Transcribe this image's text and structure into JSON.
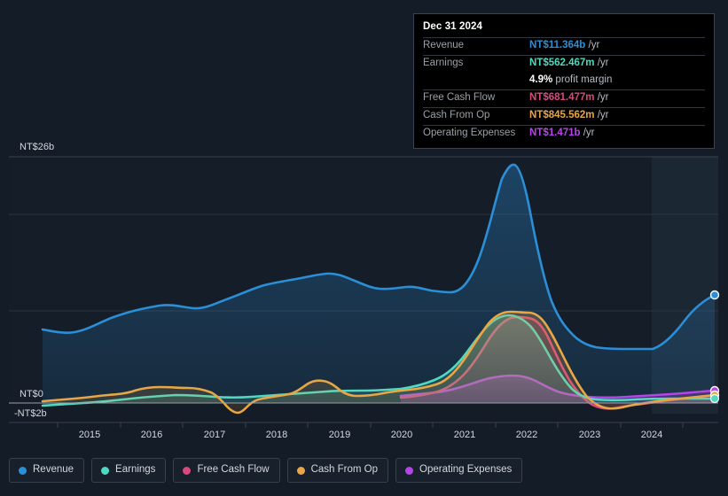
{
  "colors": {
    "background": "#141c27",
    "plot_background": "#151d28",
    "revenue": "#2b8fd8",
    "earnings": "#4fd9c0",
    "free_cash_flow": "#d64a7e",
    "cash_from_op": "#e8a646",
    "operating_expenses": "#b545e8",
    "gridline": "#3a414c",
    "zero_line": "#9aa0a8",
    "tooltip_background": "#000000",
    "tooltip_border": "#3c4350"
  },
  "tooltip": {
    "date": "Dec 31 2024",
    "rows": [
      {
        "label": "Revenue",
        "value": "NT$11.364b",
        "unit": "/yr",
        "color": "#2b8fd8"
      },
      {
        "label": "Earnings",
        "value": "NT$562.467m",
        "unit": "/yr",
        "color": "#4fd9c0"
      },
      {
        "label": "",
        "value": "4.9%",
        "unit": "profit margin",
        "color": "#ffffff"
      },
      {
        "label": "Free Cash Flow",
        "value": "NT$681.477m",
        "unit": "/yr",
        "color": "#d64a7e"
      },
      {
        "label": "Cash From Op",
        "value": "NT$845.562m",
        "unit": "/yr",
        "color": "#e8a646"
      },
      {
        "label": "Operating Expenses",
        "value": "NT$1.471b",
        "unit": "/yr",
        "color": "#b545e8"
      }
    ]
  },
  "legend": {
    "items": [
      {
        "label": "Revenue",
        "color": "#2b8fd8"
      },
      {
        "label": "Earnings",
        "color": "#4fd9c0"
      },
      {
        "label": "Free Cash Flow",
        "color": "#d64a7e"
      },
      {
        "label": "Cash From Op",
        "color": "#e8a646"
      },
      {
        "label": "Operating Expenses",
        "color": "#b545e8"
      }
    ]
  },
  "axis": {
    "y_top_label": "NT$26b",
    "y_zero_label": "NT$0",
    "y_bottom_label": "-NT$2b",
    "x_labels": [
      "2015",
      "2016",
      "2017",
      "2018",
      "2019",
      "2020",
      "2021",
      "2022",
      "2023",
      "2024"
    ]
  },
  "chart_data": {
    "type": "area",
    "title": "",
    "xlabel": "",
    "ylabel": "",
    "ylim": [
      -2,
      26
    ],
    "currency": "NT$",
    "units": "billions",
    "grid": true,
    "legend_position": "bottom",
    "x": [
      2014.5,
      2015.0,
      2015.5,
      2016.0,
      2016.5,
      2017.0,
      2017.5,
      2018.0,
      2018.5,
      2019.0,
      2019.5,
      2020.0,
      2020.5,
      2021.0,
      2021.5,
      2021.8,
      2022.0,
      2022.5,
      2023.0,
      2023.5,
      2024.0,
      2024.5,
      2025.0
    ],
    "x_tick_labels": [
      "2015",
      "2016",
      "2017",
      "2018",
      "2019",
      "2020",
      "2021",
      "2022",
      "2023",
      "2024"
    ],
    "series": [
      {
        "name": "Revenue",
        "color": "#2b8fd8",
        "values": [
          7.6,
          7.3,
          7.8,
          8.6,
          8.5,
          9.3,
          9.8,
          9.6,
          10.3,
          10.4,
          10.0,
          10.2,
          10.7,
          11.0,
          19.5,
          25.6,
          23.5,
          14.0,
          9.3,
          9.1,
          9.0,
          10.2,
          11.364
        ],
        "latest_value": "NT$11.364b"
      },
      {
        "name": "Earnings",
        "color": "#4fd9c0",
        "values": [
          -0.35,
          -0.3,
          -0.15,
          0.05,
          0.1,
          0.1,
          0.05,
          0.1,
          0.15,
          0.2,
          0.25,
          0.35,
          0.6,
          1.4,
          3.9,
          5.5,
          5.2,
          2.2,
          0.45,
          0.35,
          0.4,
          0.5,
          0.562
        ],
        "latest_value": "NT$562.467m",
        "profit_margin": "4.9%"
      },
      {
        "name": "Free Cash Flow",
        "color": "#d64a7e",
        "values": [
          0.0,
          0.0,
          0.0,
          0.0,
          0.0,
          0.0,
          0.0,
          0.0,
          0.0,
          0.0,
          0.25,
          0.4,
          0.7,
          1.5,
          4.1,
          5.4,
          5.1,
          1.9,
          -0.3,
          -0.25,
          0.2,
          0.5,
          0.681
        ],
        "latest_value": "NT$681.477m"
      },
      {
        "name": "Cash From Op",
        "color": "#e8a646",
        "values": [
          0.1,
          0.15,
          0.3,
          0.55,
          0.6,
          0.55,
          0.35,
          -0.55,
          0.25,
          0.6,
          1.1,
          0.75,
          0.9,
          1.7,
          4.4,
          5.7,
          5.6,
          2.3,
          -0.15,
          -0.1,
          0.35,
          0.7,
          0.846
        ],
        "latest_value": "NT$845.562m"
      },
      {
        "name": "Operating Expenses",
        "color": "#b545e8",
        "values": [
          null,
          null,
          null,
          null,
          null,
          null,
          null,
          null,
          null,
          null,
          null,
          0.75,
          0.9,
          1.1,
          1.5,
          1.7,
          1.65,
          1.3,
          1.15,
          1.2,
          1.25,
          1.35,
          1.471
        ],
        "latest_value": "NT$1.471b"
      }
    ]
  }
}
